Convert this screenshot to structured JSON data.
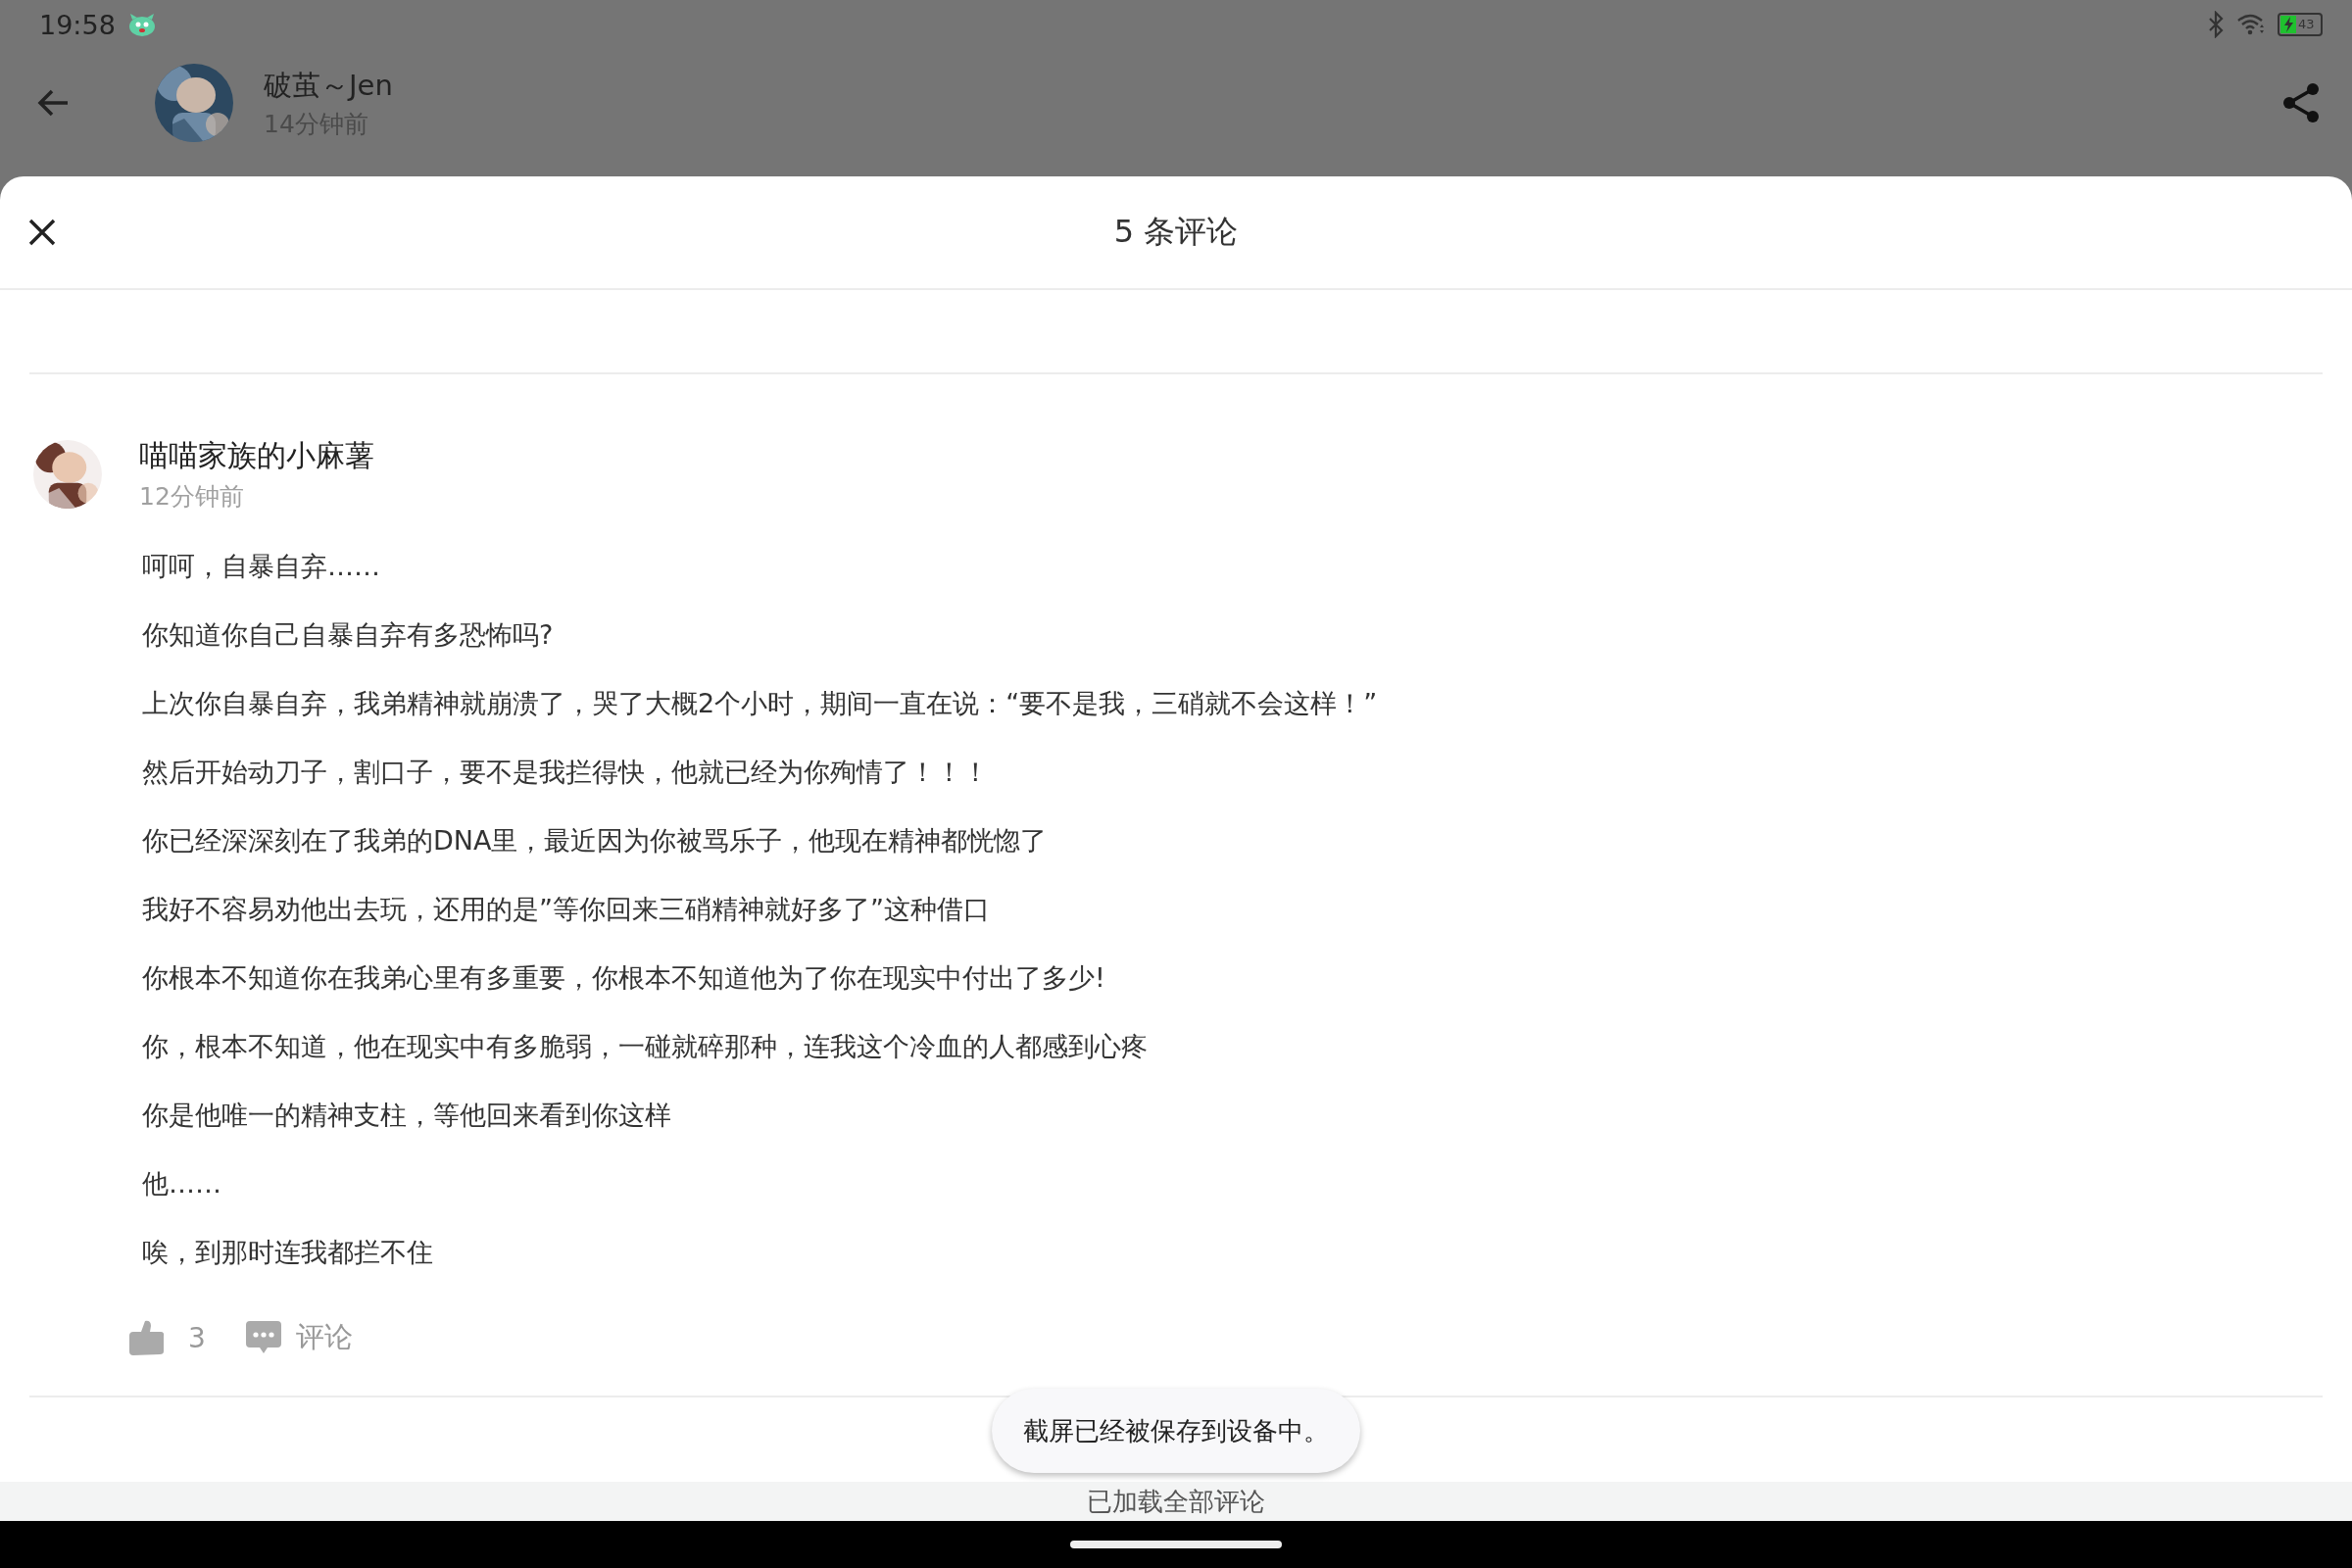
{
  "status_bar": {
    "time": "19:58",
    "battery": "43"
  },
  "post": {
    "author": "破茧～Jen",
    "time": "14分钟前"
  },
  "sheet": {
    "title": "5 条评论"
  },
  "comments": [
    {
      "author": "喵喵家族的小麻薯",
      "time": "12分钟前",
      "likes": "3",
      "reply_label": "评论",
      "paragraphs": [
        "呵呵，自暴自弃……",
        "你知道你自己自暴自弃有多恐怖吗?",
        "上次你自暴自弃，我弟精神就崩溃了，哭了大概2个小时，期间一直在说：“要不是我，三硝就不会这样！”",
        "然后开始动刀子，割口子，要不是我拦得快，他就已经为你殉情了！！！",
        "你已经深深刻在了我弟的DNA里，最近因为你被骂乐子，他现在精神都恍惚了",
        "我好不容易劝他出去玩，还用的是”等你回来三硝精神就好多了”这种借口",
        "你根本不知道你在我弟心里有多重要，你根本不知道他为了你在现实中付出了多少!",
        "你，根本不知道，他在现实中有多脆弱，一碰就碎那种，连我这个冷血的人都感到心疼",
        "你是他唯一的精神支柱，等他回来看到你这样",
        "他……",
        "唉，到那时连我都拦不住"
      ]
    }
  ],
  "toast": "截屏已经被保存到设备中。",
  "footer": "已加载全部评论"
}
